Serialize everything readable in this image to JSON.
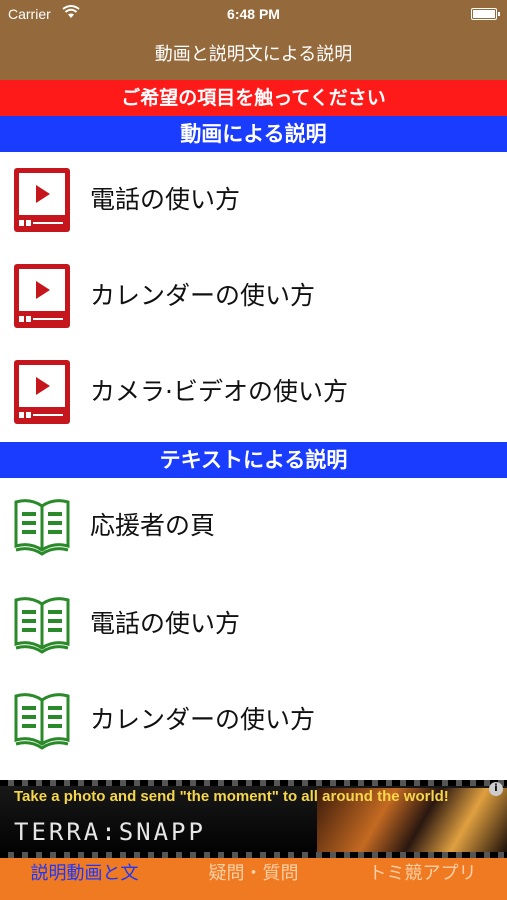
{
  "status_bar": {
    "carrier": "Carrier",
    "time": "6:48 PM"
  },
  "nav": {
    "title": "動画と説明文による説明"
  },
  "prompt": "ご希望の項目を触ってください",
  "video_section": {
    "header": "動画による説明",
    "items": [
      {
        "label": "電話の使い方",
        "icon": "video-player-icon"
      },
      {
        "label": "カレンダーの使い方",
        "icon": "video-player-icon"
      },
      {
        "label": "カメラ·ビデオの使い方",
        "icon": "video-player-icon"
      }
    ]
  },
  "text_section": {
    "header": "テキストによる説明",
    "items": [
      {
        "label": "応援者の頁",
        "icon": "open-book-icon"
      },
      {
        "label": "電話の使い方",
        "icon": "open-book-icon"
      },
      {
        "label": "カレンダーの使い方",
        "icon": "open-book-icon"
      }
    ]
  },
  "ad": {
    "tagline": "Take a photo and send  \"the moment\" to all around the world!",
    "logo": "TERRA:SNAPP",
    "info": "i"
  },
  "tabs": [
    {
      "label": "説明動画と文",
      "active": true
    },
    {
      "label": "疑問・質問",
      "active": false
    },
    {
      "label": "トミ競アプリ",
      "active": false
    }
  ],
  "colors": {
    "brown": "#946a3d",
    "red": "#ff1a1a",
    "blue": "#1a3cff",
    "orange": "#ef7a22",
    "video_icon": "#c4161c",
    "book_icon": "#2a8a2a"
  }
}
